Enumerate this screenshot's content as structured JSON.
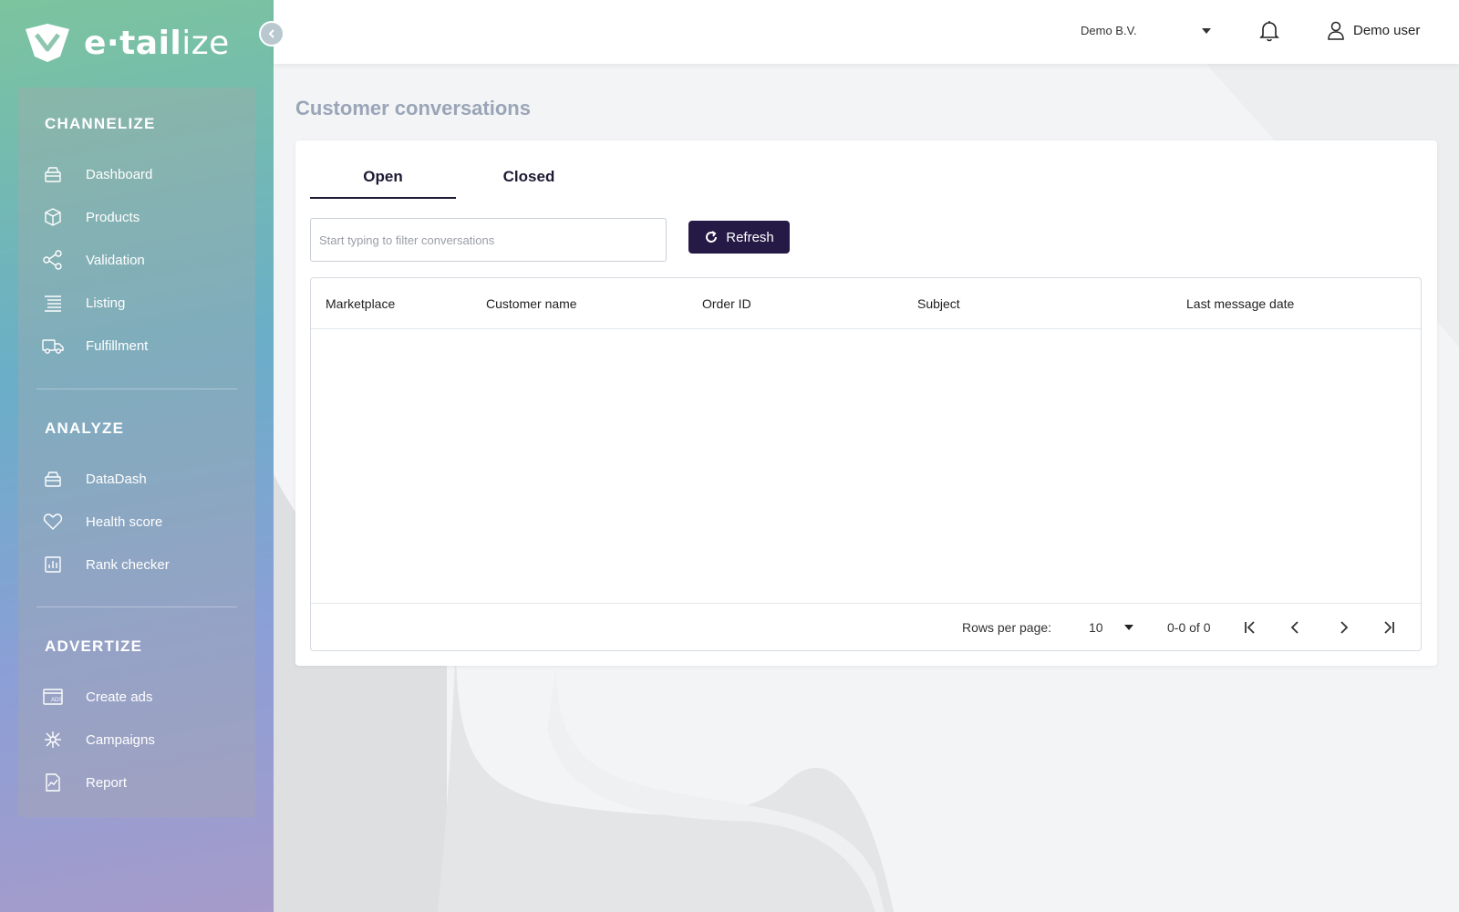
{
  "brand": {
    "name_bold": "e·tail",
    "name_thin": "ize"
  },
  "sidebar": {
    "sections": [
      {
        "title": "CHANNELIZE",
        "items": [
          {
            "label": "Dashboard",
            "icon": "box-stack-icon"
          },
          {
            "label": "Products",
            "icon": "cube-icon"
          },
          {
            "label": "Validation",
            "icon": "share-nodes-icon"
          },
          {
            "label": "Listing",
            "icon": "list-lines-icon"
          },
          {
            "label": "Fulfillment",
            "icon": "truck-icon"
          }
        ]
      },
      {
        "title": "ANALYZE",
        "items": [
          {
            "label": "DataDash",
            "icon": "box-stack-icon"
          },
          {
            "label": "Health score",
            "icon": "heart-icon"
          },
          {
            "label": "Rank checker",
            "icon": "bar-chart-icon"
          }
        ]
      },
      {
        "title": "ADVERTIZE",
        "items": [
          {
            "label": "Create ads",
            "icon": "ads-icon"
          },
          {
            "label": "Campaigns",
            "icon": "network-icon"
          },
          {
            "label": "Report",
            "icon": "report-icon"
          }
        ]
      }
    ]
  },
  "topbar": {
    "company": "Demo B.V.",
    "user": "Demo user"
  },
  "main": {
    "title": "Customer conversations",
    "tabs": [
      {
        "label": "Open",
        "active": true
      },
      {
        "label": "Closed",
        "active": false
      }
    ],
    "filter": {
      "placeholder": "Start typing to filter conversations",
      "value": ""
    },
    "refresh_label": "Refresh",
    "table": {
      "columns": [
        "Marketplace",
        "Customer name",
        "Order ID",
        "Subject",
        "Last message date"
      ],
      "rows": []
    },
    "pagination": {
      "rows_per_page_label": "Rows per page:",
      "rows_per_page": "10",
      "range": "0-0 of 0"
    }
  },
  "colors": {
    "accent": "#241a45",
    "title": "#9aa5b8"
  }
}
